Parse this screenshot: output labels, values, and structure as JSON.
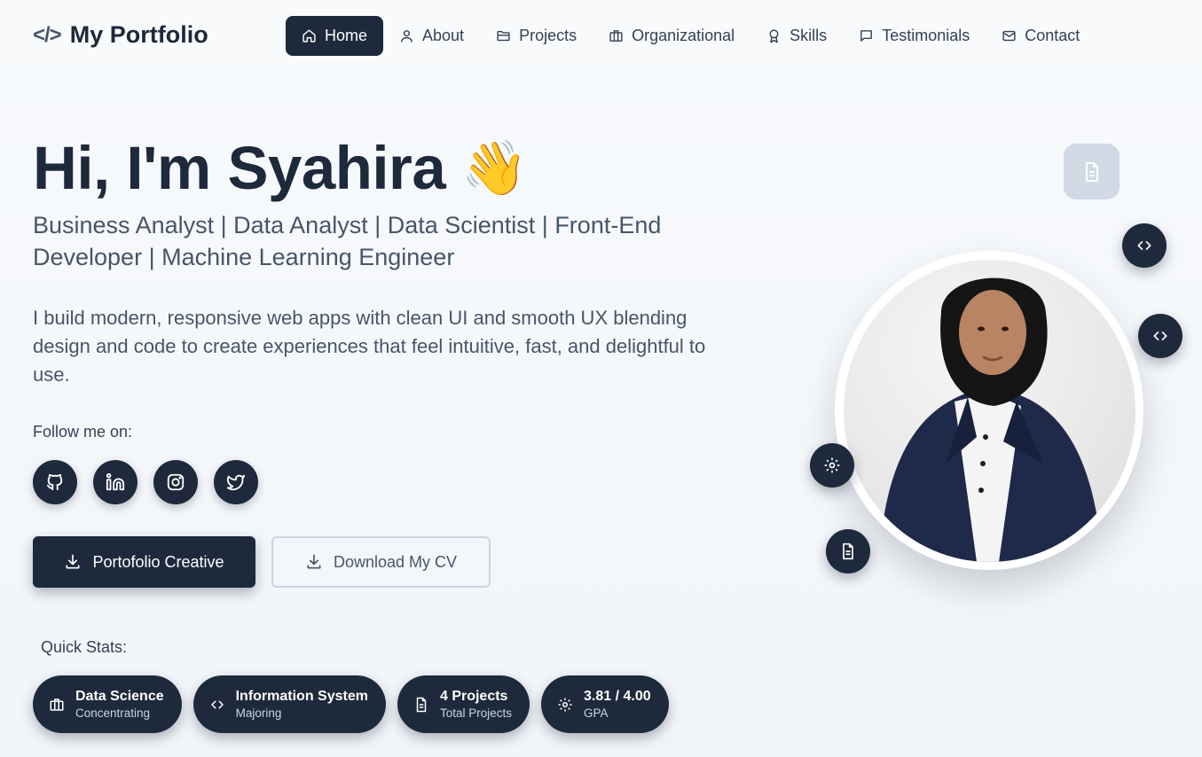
{
  "nav": {
    "logo_code": "</>",
    "logo_text": "My Portfolio",
    "items": [
      {
        "label": "Home",
        "icon": "home-icon",
        "active": true
      },
      {
        "label": "About",
        "icon": "user-icon",
        "active": false
      },
      {
        "label": "Projects",
        "icon": "folder-icon",
        "active": false
      },
      {
        "label": "Organizational",
        "icon": "briefcase-icon",
        "active": false
      },
      {
        "label": "Skills",
        "icon": "award-icon",
        "active": false
      },
      {
        "label": "Testimonials",
        "icon": "message-icon",
        "active": false
      },
      {
        "label": "Contact",
        "icon": "mail-icon",
        "active": false
      }
    ]
  },
  "hero": {
    "greeting": "Hi, I'm Syahira",
    "wave": "👋",
    "roles": "Business Analyst | Data Analyst | Data Scientist | Front-End Developer | Machine Learning Engineer",
    "intro": "I build modern, responsive web apps with clean UI and smooth UX blending design and code to create experiences that feel intuitive, fast, and delightful to use.",
    "follow_label": "Follow me on:",
    "socials": [
      "github-icon",
      "linkedin-icon",
      "instagram-icon",
      "twitter-icon"
    ],
    "primary_button": "Portofolio Creative",
    "secondary_button": "Download My CV"
  },
  "stats": {
    "label": "Quick Stats:",
    "items": [
      {
        "title": "Data Science",
        "sub": "Concentrating",
        "icon": "briefcase-icon"
      },
      {
        "title": "Information System",
        "sub": "Majoring",
        "icon": "code-icon"
      },
      {
        "title": "4 Projects",
        "sub": "Total Projects",
        "icon": "file-icon"
      },
      {
        "title": "3.81 / 4.00",
        "sub": "GPA",
        "icon": "gear-icon"
      }
    ]
  },
  "colors": {
    "primary": "#1e293b",
    "text_muted": "#475569",
    "background": "#f8fafc"
  }
}
